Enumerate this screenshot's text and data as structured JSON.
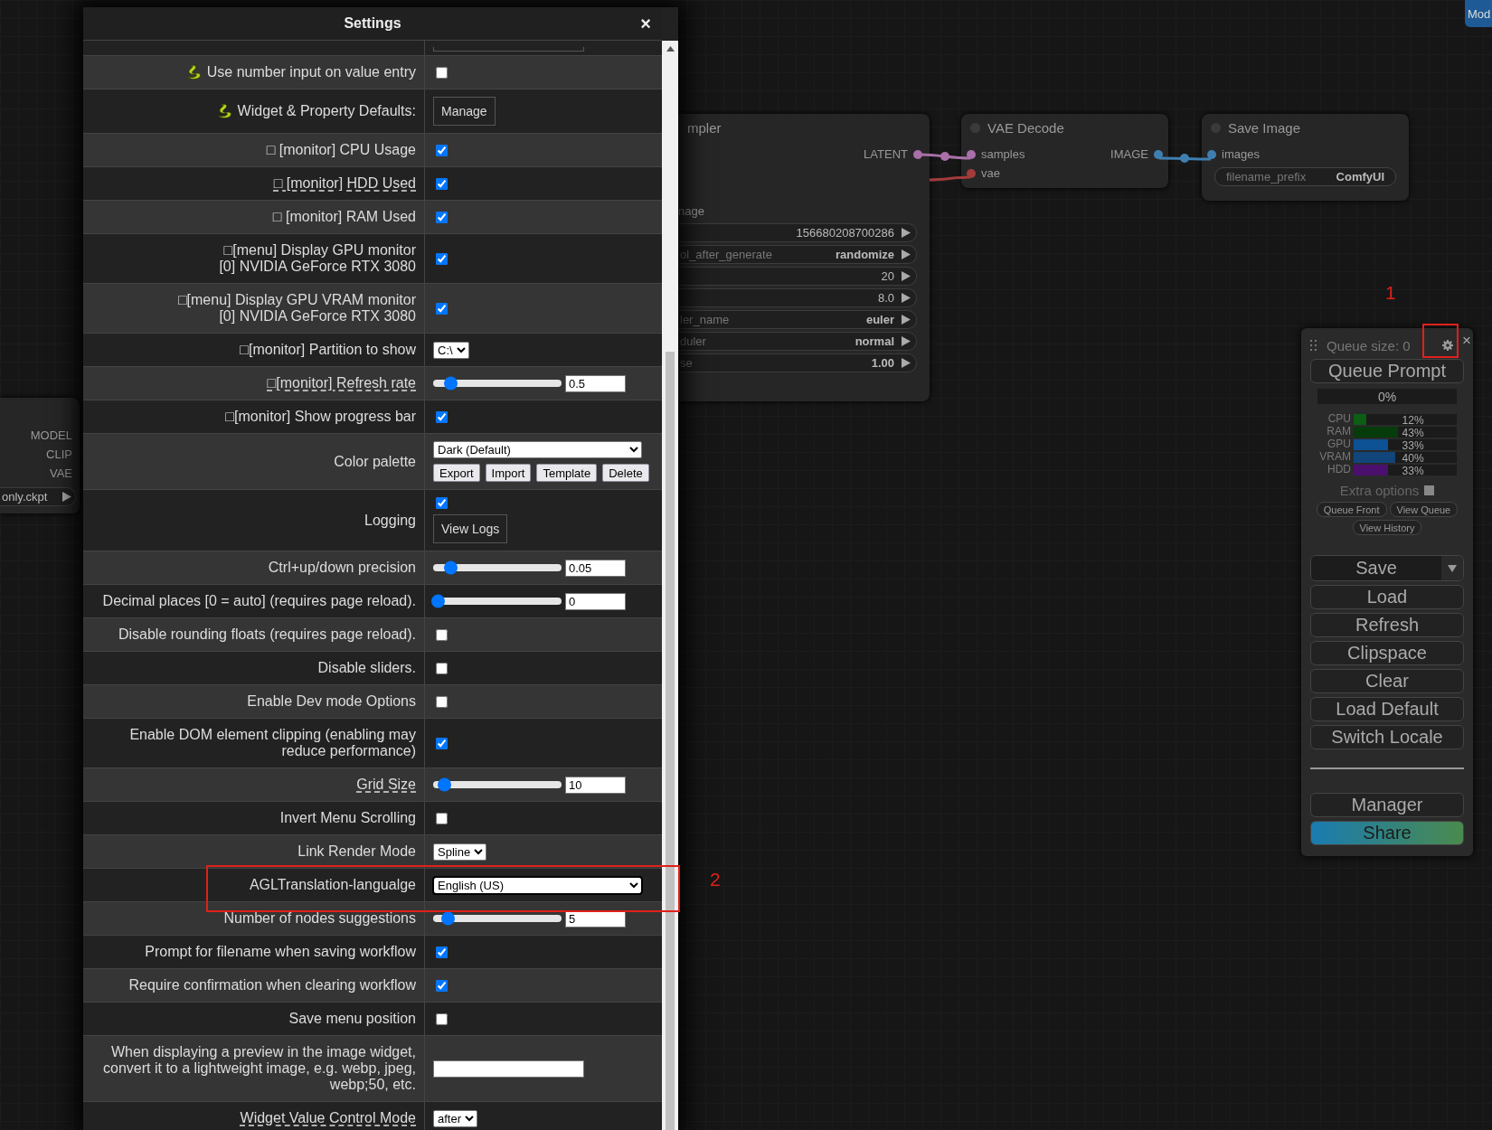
{
  "top_button": "Mod",
  "loader_node": {
    "outputs": [
      "MODEL",
      "CLIP",
      "VAE"
    ],
    "widget_value": "only.ckpt"
  },
  "sampler_node": {
    "title": "mpler",
    "output": "LATENT",
    "section": "nage",
    "widgets": [
      {
        "value": "156680208700286"
      },
      {
        "name": "ol_after_generate",
        "value": "randomize"
      },
      {
        "value": "20"
      },
      {
        "value": "8.0"
      },
      {
        "name": "ler_name",
        "value": "euler"
      },
      {
        "name": "duler",
        "value": "normal"
      },
      {
        "name": "se",
        "value": "1.00"
      }
    ]
  },
  "vae_decode": {
    "title": "VAE Decode",
    "inputs": [
      {
        "name": "samples",
        "color": "#a86fa8"
      },
      {
        "name": "vae",
        "color": "#a33b3b"
      }
    ],
    "output": "IMAGE"
  },
  "save_image": {
    "title": "Save Image",
    "input": "images",
    "widget": {
      "name": "filename_prefix",
      "value": "ComfyUI"
    }
  },
  "settings": {
    "title": "Settings",
    "close": "×",
    "rows": [
      {
        "kind": "partial"
      },
      {
        "label": "Use number input on value entry",
        "icon": true,
        "hint": false,
        "control": {
          "kind": "checkbox",
          "checked": false
        }
      },
      {
        "label": "Widget & Property Defaults:",
        "icon": true,
        "hint": false,
        "control": {
          "kind": "button",
          "label": "Manage"
        }
      },
      {
        "label": "□ [monitor] CPU Usage",
        "hint": false,
        "control": {
          "kind": "checkbox",
          "checked": true
        }
      },
      {
        "label": "□ [monitor] HDD Used",
        "hint": true,
        "control": {
          "kind": "checkbox",
          "checked": true
        }
      },
      {
        "label": "□ [monitor] RAM Used",
        "hint": false,
        "control": {
          "kind": "checkbox",
          "checked": true
        }
      },
      {
        "label": "□[menu] Display GPU monitor\n[0] NVIDIA GeForce RTX 3080",
        "hint": false,
        "control": {
          "kind": "checkbox",
          "checked": true
        }
      },
      {
        "label": "□[menu] Display GPU VRAM monitor\n[0] NVIDIA GeForce RTX 3080",
        "hint": false,
        "control": {
          "kind": "checkbox",
          "checked": true
        }
      },
      {
        "label": "□[monitor] Partition to show",
        "hint": false,
        "control": {
          "kind": "select",
          "value": "C:\\"
        }
      },
      {
        "label": "□[monitor] Refresh rate",
        "hint": true,
        "control": {
          "kind": "slider",
          "level": 0.1,
          "value": "0.5"
        }
      },
      {
        "label": "□[monitor] Show progress bar",
        "hint": false,
        "control": {
          "kind": "checkbox",
          "checked": true
        }
      },
      {
        "label": "Color palette",
        "hint": false,
        "control": {
          "kind": "palette",
          "value": "Dark (Default)",
          "buttons": [
            "Export",
            "Import",
            "Template",
            "Delete"
          ]
        }
      },
      {
        "label": "Logging",
        "hint": false,
        "control": {
          "kind": "logging",
          "checked": true,
          "button": "View Logs"
        }
      },
      {
        "label": "Ctrl+up/down precision",
        "hint": false,
        "control": {
          "kind": "slider",
          "level": 0.1,
          "value": "0.05"
        }
      },
      {
        "label": "Decimal places [0 = auto] (requires page reload).",
        "hint": false,
        "control": {
          "kind": "slider",
          "level": 0,
          "value": "0"
        }
      },
      {
        "label": "Disable rounding floats (requires page reload).",
        "hint": false,
        "control": {
          "kind": "checkbox",
          "checked": false
        }
      },
      {
        "label": "Disable sliders.",
        "hint": false,
        "control": {
          "kind": "checkbox",
          "checked": false
        }
      },
      {
        "label": "Enable Dev mode Options",
        "hint": false,
        "control": {
          "kind": "checkbox",
          "checked": false
        }
      },
      {
        "label": "Enable DOM element clipping (enabling may\nreduce performance)",
        "hint": false,
        "control": {
          "kind": "checkbox",
          "checked": true
        }
      },
      {
        "label": "Grid Size",
        "hint": true,
        "control": {
          "kind": "slider",
          "level": 0.05,
          "value": "10"
        }
      },
      {
        "label": "Invert Menu Scrolling",
        "hint": false,
        "control": {
          "kind": "checkbox",
          "checked": false
        }
      },
      {
        "label": "Link Render Mode",
        "hint": false,
        "control": {
          "kind": "select",
          "value": "Spline"
        }
      },
      {
        "label": "AGLTranslation-langualge",
        "hint": false,
        "control": {
          "kind": "wide_select",
          "value": "English (US)",
          "focused": true
        }
      },
      {
        "label": "Number of nodes suggestions",
        "hint": false,
        "control": {
          "kind": "slider",
          "level": 0.08,
          "value": "5"
        }
      },
      {
        "label": "Prompt for filename when saving workflow",
        "hint": false,
        "control": {
          "kind": "checkbox",
          "checked": true
        }
      },
      {
        "label": "Require confirmation when clearing workflow",
        "hint": false,
        "control": {
          "kind": "checkbox",
          "checked": true
        }
      },
      {
        "label": "Save menu position",
        "hint": false,
        "control": {
          "kind": "checkbox",
          "checked": false
        }
      },
      {
        "label": "When displaying a preview in the image widget,\nconvert it to a lightweight image, e.g. webp, jpeg,\nwebp;50, etc.",
        "hint": false,
        "control": {
          "kind": "text"
        }
      },
      {
        "label": "Widget Value Control Mode",
        "hint": true,
        "control": {
          "kind": "select",
          "value": "after"
        }
      }
    ]
  },
  "queue_panel": {
    "queue_size": "Queue size: 0",
    "close": "×",
    "queue_button": "Queue Prompt",
    "progress": {
      "text": "0%",
      "level": 0
    },
    "monitors": [
      {
        "label": "CPU",
        "reading": "12%",
        "level": 0.12,
        "color": "#0c5e14"
      },
      {
        "label": "RAM",
        "reading": "43%",
        "level": 0.43,
        "color": "#063b0b"
      },
      {
        "label": "GPU",
        "reading": "33%",
        "level": 0.33,
        "color": "#0d5195"
      },
      {
        "label": "VRAM",
        "reading": "40%",
        "level": 0.4,
        "color": "#12457a"
      },
      {
        "label": "HDD",
        "reading": "33%",
        "level": 0.33,
        "color": "#4b0f6d"
      }
    ],
    "extra_options": {
      "label": "Extra options",
      "checked": false
    },
    "small_buttons": [
      "Queue Front",
      "View Queue",
      "View History"
    ],
    "save": "Save",
    "buttons": [
      "Load",
      "Refresh",
      "Clipspace",
      "Clear",
      "Load Default",
      "Switch Locale"
    ],
    "footer_buttons": [
      {
        "label": "Manager",
        "kind": "plain"
      },
      {
        "label": "Share",
        "kind": "gradient"
      }
    ]
  },
  "annotations": [
    {
      "number": "1"
    },
    {
      "number": "2"
    }
  ]
}
